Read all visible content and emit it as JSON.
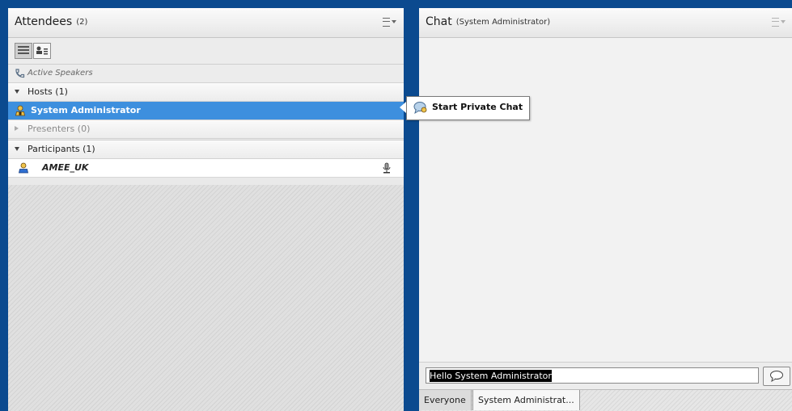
{
  "attendees": {
    "title": "Attendees",
    "count": "(2)",
    "active_speakers": "Active Speakers",
    "hosts": {
      "label": "Hosts (1)",
      "members": [
        "System Administrator"
      ]
    },
    "presenters": {
      "label": "Presenters (0)"
    },
    "participants": {
      "label": "Participants (1)",
      "members": [
        "AMEE_UK"
      ]
    }
  },
  "chat": {
    "title": "Chat",
    "subtitle": "(System Administrator)",
    "input_value": "Hello System Administrator",
    "tabs": [
      "Everyone",
      "System Administrat..."
    ]
  },
  "context_menu": {
    "start_private_chat": "Start Private Chat"
  },
  "colors": {
    "background": "#0b4a8f",
    "selection": "#3d8fde"
  },
  "icons": [
    "menu-icon",
    "list-view-icon",
    "attendee-status-view-icon",
    "phone-icon",
    "host-user-icon",
    "participant-user-icon",
    "microphone-icon",
    "chat-bubble-icon",
    "send-icon"
  ]
}
